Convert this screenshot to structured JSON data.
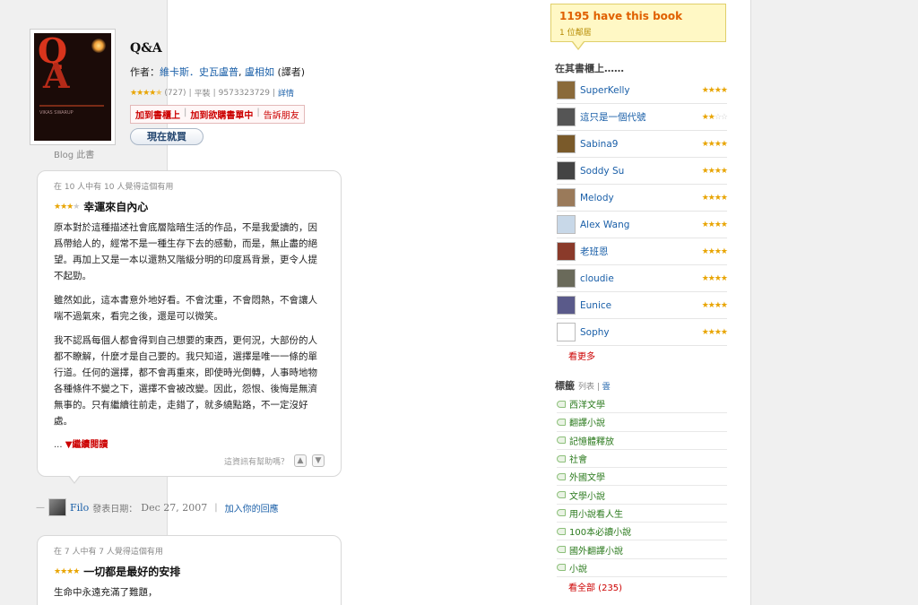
{
  "book": {
    "title": "Q&A",
    "author_prefix": "作者：",
    "author": "維卡斯．史瓦盧普",
    "translator": "盧相如",
    "translator_suffix": "(譯者)",
    "ratings": "(727)",
    "format": "平裝",
    "isbn": "9573323729",
    "detail_link": "詳情",
    "add_shelf": "加到書櫃上",
    "add_wishlist": "加到欲購書單中",
    "tell_friend": "告訴朋友",
    "buy_label": "現在就買",
    "blog_link": "Blog 此書",
    "cover_tiny_text": "VIKAS SWARUP"
  },
  "review1": {
    "helpful": "在 10 人中有 10 人覺得這個有用",
    "title": "幸運來自內心",
    "stars": 3,
    "paragraphs": [
      "原本對於這種描述社會底層陰暗生活的作品，不是我愛讀的，因爲帶給人的，經常不是一種生存下去的感動，而是，無止盡的絕望。再加上又是一本以還熟又階級分明的印度爲背景，更令人提不起勁。",
      "雖然如此，這本書意外地好看。不會沈重，不會悶熱，不會讓人喘不過氣來，看完之後，還是可以微笑。",
      "我不認爲每個人都會得到自己想要的東西，更何況，大部份的人都不瞭解，什麼才是自己要的。我只知道，選擇是唯一一條的單行道。任何的選擇，都不會再重來，即使時光倒轉，人事時地物各種條件不變之下，選擇不會被改變。因此，怨恨、後悔是無濟無事的。只有繼續往前走，走錯了，就多繞點路，不一定沒好處。"
    ],
    "more_prefix": "...",
    "more_label": "▼繼續閱讀",
    "helpful_q": "這資訊有幫助嗎？",
    "poster": "Filo",
    "posted_label": "發表日期：",
    "posted_date": "Dec 27, 2007",
    "reply_link": "加入你的回應"
  },
  "review2": {
    "helpful": "在 7 人中有 7 人覺得這個有用",
    "title": "一切都是最好的安排",
    "stars": 4,
    "first_line": "生命中永遠充滿了難題，"
  },
  "sidebar": {
    "have_count": "1195 have this book",
    "neighbors": "1 位鄰居",
    "shelf_heading": "在其書櫃上……",
    "shelf_users": [
      {
        "name": "SuperKelly",
        "stars": 4,
        "color": "#8a6a3a"
      },
      {
        "name": "這只是一個代號",
        "stars": 2,
        "color": "#555555"
      },
      {
        "name": "Sabina9",
        "stars": 4,
        "color": "#7a5a2a"
      },
      {
        "name": "Soddy Su",
        "stars": 4,
        "color": "#444444"
      },
      {
        "name": "Melody",
        "stars": 4,
        "color": "#9a7a5a"
      },
      {
        "name": "Alex Wang",
        "stars": 4,
        "color": "#c8d8e8"
      },
      {
        "name": "老班恩",
        "stars": 4,
        "color": "#8a3a2a"
      },
      {
        "name": "cloudie",
        "stars": 4,
        "color": "#6a6a5a"
      },
      {
        "name": "Eunice",
        "stars": 4,
        "color": "#5a5a8a"
      },
      {
        "name": "Sophy",
        "stars": 4,
        "color": "#ffffff"
      }
    ],
    "see_more": "看更多",
    "tags_heading": "標籤",
    "tags_list": "列表",
    "tags_cloud": "雲",
    "tags": [
      "西洋文學",
      "翻譯小說",
      "記憶體釋放",
      "社會",
      "外國文學",
      "文學小說",
      "用小說看人生",
      "100本必讀小說",
      "國外翻譯小說",
      "小說"
    ],
    "all_tags": "看全部 (235)"
  }
}
